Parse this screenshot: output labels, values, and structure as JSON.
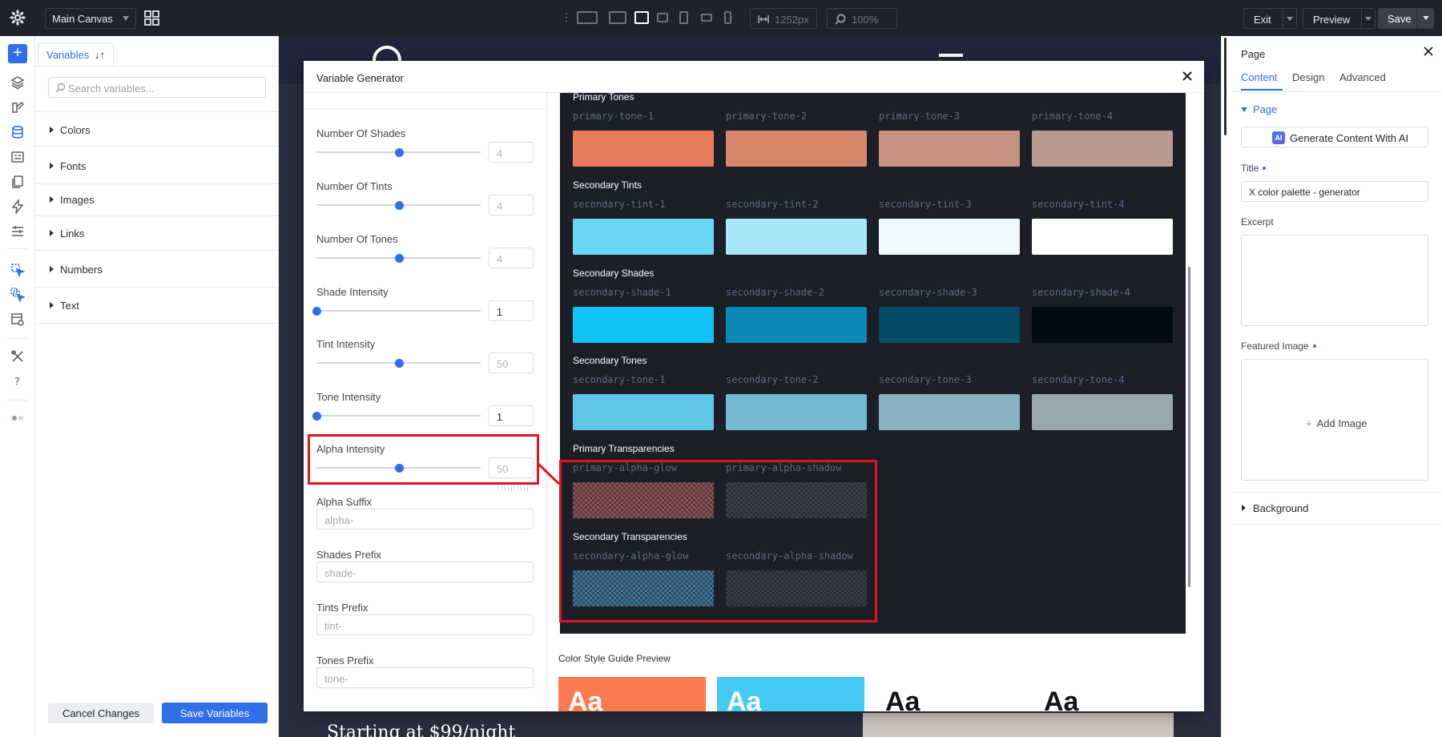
{
  "topbar": {
    "canvas_select": "Main Canvas",
    "width_value": "1252px",
    "zoom_value": "100%",
    "exit_label": "Exit",
    "preview_label": "Preview",
    "save_label": "Save"
  },
  "variables_panel": {
    "tab_label": "Variables",
    "sort_glyph": "↓↑",
    "search_placeholder": "Search variables...",
    "categories": [
      "Colors",
      "Fonts",
      "Images",
      "Links",
      "Numbers",
      "Text"
    ],
    "cancel_label": "Cancel Changes",
    "save_label": "Save Variables"
  },
  "canvas": {
    "price_text": "Starting at $99/night"
  },
  "modal": {
    "title": "Variable Generator",
    "fields": [
      {
        "label": "Number Of Shades",
        "value": "4",
        "slider": 0.5
      },
      {
        "label": "Number Of Tints",
        "value": "4",
        "slider": 0.5
      },
      {
        "label": "Number Of Tones",
        "value": "4",
        "slider": 0.5
      },
      {
        "label": "Shade Intensity",
        "value": "1",
        "slider": 0.0
      },
      {
        "label": "Tint Intensity",
        "value": "50",
        "slider": 0.5
      },
      {
        "label": "Tone Intensity",
        "value": "1",
        "slider": 0.0
      },
      {
        "label": "Alpha Intensity",
        "value": "50",
        "slider": 0.5
      }
    ],
    "text_fields": [
      {
        "label": "Alpha Suffix",
        "placeholder": "alpha-"
      },
      {
        "label": "Shades Prefix",
        "placeholder": "shade-"
      },
      {
        "label": "Tints Prefix",
        "placeholder": "tint-"
      },
      {
        "label": "Tones Prefix",
        "placeholder": "tone-"
      }
    ],
    "groups": [
      {
        "title": "Primary Tones",
        "swatches": [
          {
            "name": "primary-tone-1",
            "color": "#e97b5a"
          },
          {
            "name": "primary-tone-2",
            "color": "#d7876c"
          },
          {
            "name": "primary-tone-3",
            "color": "#c7917f"
          },
          {
            "name": "primary-tone-4",
            "color": "#b99a91"
          }
        ]
      },
      {
        "title": "Secondary Tints",
        "swatches": [
          {
            "name": "secondary-tint-1",
            "color": "#6ad7f7"
          },
          {
            "name": "secondary-tint-2",
            "color": "#a8e6f9"
          },
          {
            "name": "secondary-tint-3",
            "color": "#eef9fd"
          },
          {
            "name": "secondary-tint-4",
            "color": "#ffffff"
          }
        ]
      },
      {
        "title": "Secondary Shades",
        "swatches": [
          {
            "name": "secondary-shade-1",
            "color": "#12c3f8"
          },
          {
            "name": "secondary-shade-2",
            "color": "#0a89b8"
          },
          {
            "name": "secondary-shade-3",
            "color": "#044c66"
          },
          {
            "name": "secondary-shade-4",
            "color": "#020c10"
          }
        ]
      },
      {
        "title": "Secondary Tones",
        "swatches": [
          {
            "name": "secondary-tone-1",
            "color": "#5ec6e8"
          },
          {
            "name": "secondary-tone-2",
            "color": "#73b8d1"
          },
          {
            "name": "secondary-tone-3",
            "color": "#88b0c0"
          },
          {
            "name": "secondary-tone-4",
            "color": "#98a7ad"
          }
        ]
      },
      {
        "title": "Primary Transparencies",
        "swatches": [
          {
            "name": "primary-alpha-glow",
            "color": "#8a4f4f",
            "pattern": "#5a3a3e"
          },
          {
            "name": "primary-alpha-shadow",
            "color": "#2a2e37",
            "pattern": "#3b3f49"
          }
        ]
      },
      {
        "title": "Secondary Transparencies",
        "swatches": [
          {
            "name": "secondary-alpha-glow",
            "color": "#3f7290",
            "pattern": "#2c4f66"
          },
          {
            "name": "secondary-alpha-shadow",
            "color": "#272c37",
            "pattern": "#363b47"
          }
        ]
      }
    ],
    "style_guide": {
      "title": "Color Style Guide Preview",
      "cards": [
        {
          "text": "Aa",
          "color": "#fb7a4f"
        },
        {
          "text": "Aa",
          "color": "#45c9f5"
        },
        {
          "text": "Aa",
          "color": "#ffffff"
        },
        {
          "text": "Aa",
          "color": "#ffffff"
        }
      ]
    }
  },
  "right_panel": {
    "title": "Page",
    "tabs": [
      "Content",
      "Design",
      "Advanced"
    ],
    "section": "Page",
    "ai_badge": "AI",
    "ai_button": "Generate Content With AI",
    "title_label": "Title",
    "title_value": "X color palette - generator",
    "excerpt_label": "Excerpt",
    "featured_label": "Featured Image",
    "add_image": "Add Image",
    "background_label": "Background"
  },
  "colors": {
    "accent": "#2f6fe8",
    "highlight": "#e0141e",
    "topbar": "#1f2329"
  }
}
